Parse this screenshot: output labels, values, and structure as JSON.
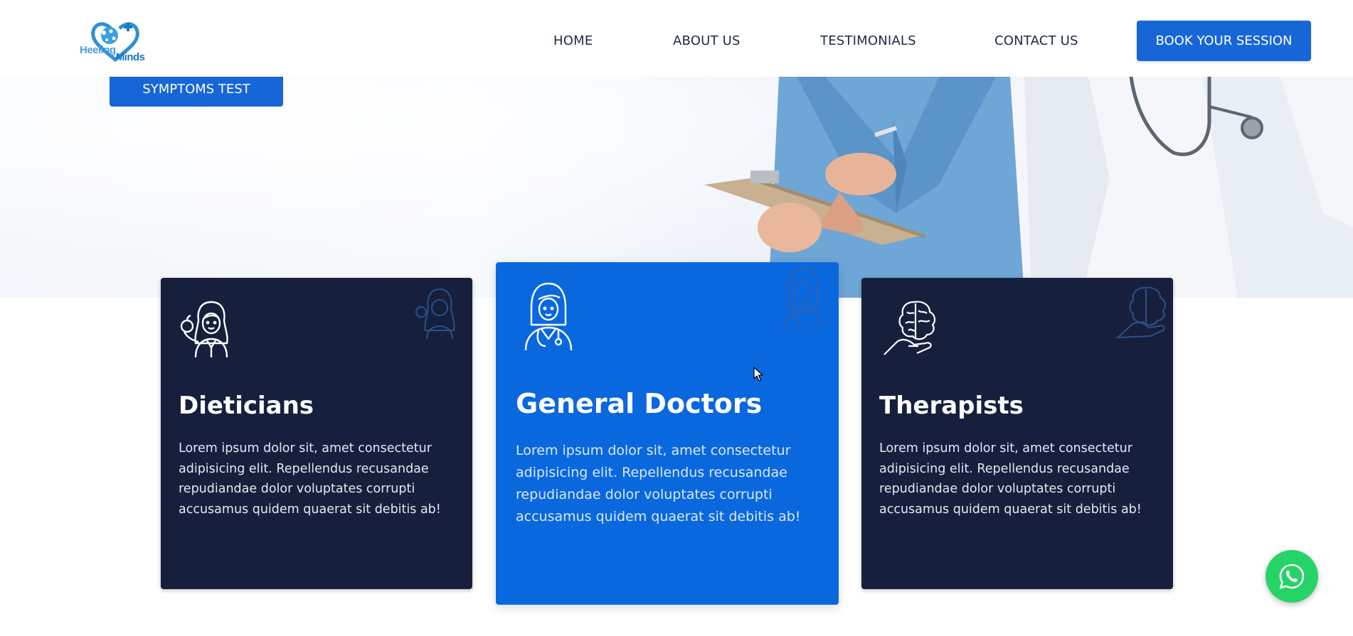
{
  "brand": {
    "logo_word1": "Heeling",
    "logo_word2": "Minds"
  },
  "nav": {
    "home": "HOME",
    "about": "ABOUT US",
    "testimonials": "TESTIMONIALS",
    "contact": "CONTACT US",
    "book": "BOOK YOUR SESSION"
  },
  "hero": {
    "symptoms_button": "SYMPTOMS TEST"
  },
  "cards": [
    {
      "title": "Dieticians",
      "text": "Lorem ipsum dolor sit, amet consectetur adipisicing elit. Repellendus recusandae repudiandae dolor voluptates corrupti accusamus quidem quaerat sit debitis ab!",
      "icon": "dietician-woman-icon"
    },
    {
      "title": "General Doctors",
      "text": "Lorem ipsum dolor sit, amet consectetur adipisicing elit. Repellendus recusandae repudiandae dolor voluptates corrupti accusamus quidem quaerat sit debitis ab!",
      "icon": "doctor-woman-icon"
    },
    {
      "title": "Therapists",
      "text": "Lorem ipsum dolor sit, amet consectetur adipisicing elit. Repellendus recusandae repudiandae dolor voluptates corrupti accusamus quidem quaerat sit debitis ab!",
      "icon": "brain-hand-icon"
    }
  ],
  "colors": {
    "primary": "#1666d8",
    "card_dark": "#16203d",
    "card_blue": "#0a68df",
    "whatsapp": "#26d367"
  },
  "floating": {
    "whatsapp_icon": "whatsapp-icon"
  }
}
